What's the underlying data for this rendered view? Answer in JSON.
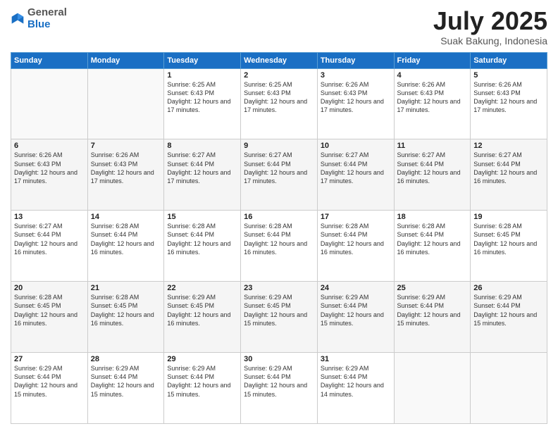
{
  "header": {
    "logo_general": "General",
    "logo_blue": "Blue",
    "month": "July 2025",
    "location": "Suak Bakung, Indonesia"
  },
  "weekdays": [
    "Sunday",
    "Monday",
    "Tuesday",
    "Wednesday",
    "Thursday",
    "Friday",
    "Saturday"
  ],
  "weeks": [
    [
      {
        "day": "",
        "sunrise": "",
        "sunset": "",
        "daylight": ""
      },
      {
        "day": "",
        "sunrise": "",
        "sunset": "",
        "daylight": ""
      },
      {
        "day": "1",
        "sunrise": "Sunrise: 6:25 AM",
        "sunset": "Sunset: 6:43 PM",
        "daylight": "Daylight: 12 hours and 17 minutes."
      },
      {
        "day": "2",
        "sunrise": "Sunrise: 6:25 AM",
        "sunset": "Sunset: 6:43 PM",
        "daylight": "Daylight: 12 hours and 17 minutes."
      },
      {
        "day": "3",
        "sunrise": "Sunrise: 6:26 AM",
        "sunset": "Sunset: 6:43 PM",
        "daylight": "Daylight: 12 hours and 17 minutes."
      },
      {
        "day": "4",
        "sunrise": "Sunrise: 6:26 AM",
        "sunset": "Sunset: 6:43 PM",
        "daylight": "Daylight: 12 hours and 17 minutes."
      },
      {
        "day": "5",
        "sunrise": "Sunrise: 6:26 AM",
        "sunset": "Sunset: 6:43 PM",
        "daylight": "Daylight: 12 hours and 17 minutes."
      }
    ],
    [
      {
        "day": "6",
        "sunrise": "Sunrise: 6:26 AM",
        "sunset": "Sunset: 6:43 PM",
        "daylight": "Daylight: 12 hours and 17 minutes."
      },
      {
        "day": "7",
        "sunrise": "Sunrise: 6:26 AM",
        "sunset": "Sunset: 6:43 PM",
        "daylight": "Daylight: 12 hours and 17 minutes."
      },
      {
        "day": "8",
        "sunrise": "Sunrise: 6:27 AM",
        "sunset": "Sunset: 6:44 PM",
        "daylight": "Daylight: 12 hours and 17 minutes."
      },
      {
        "day": "9",
        "sunrise": "Sunrise: 6:27 AM",
        "sunset": "Sunset: 6:44 PM",
        "daylight": "Daylight: 12 hours and 17 minutes."
      },
      {
        "day": "10",
        "sunrise": "Sunrise: 6:27 AM",
        "sunset": "Sunset: 6:44 PM",
        "daylight": "Daylight: 12 hours and 17 minutes."
      },
      {
        "day": "11",
        "sunrise": "Sunrise: 6:27 AM",
        "sunset": "Sunset: 6:44 PM",
        "daylight": "Daylight: 12 hours and 16 minutes."
      },
      {
        "day": "12",
        "sunrise": "Sunrise: 6:27 AM",
        "sunset": "Sunset: 6:44 PM",
        "daylight": "Daylight: 12 hours and 16 minutes."
      }
    ],
    [
      {
        "day": "13",
        "sunrise": "Sunrise: 6:27 AM",
        "sunset": "Sunset: 6:44 PM",
        "daylight": "Daylight: 12 hours and 16 minutes."
      },
      {
        "day": "14",
        "sunrise": "Sunrise: 6:28 AM",
        "sunset": "Sunset: 6:44 PM",
        "daylight": "Daylight: 12 hours and 16 minutes."
      },
      {
        "day": "15",
        "sunrise": "Sunrise: 6:28 AM",
        "sunset": "Sunset: 6:44 PM",
        "daylight": "Daylight: 12 hours and 16 minutes."
      },
      {
        "day": "16",
        "sunrise": "Sunrise: 6:28 AM",
        "sunset": "Sunset: 6:44 PM",
        "daylight": "Daylight: 12 hours and 16 minutes."
      },
      {
        "day": "17",
        "sunrise": "Sunrise: 6:28 AM",
        "sunset": "Sunset: 6:44 PM",
        "daylight": "Daylight: 12 hours and 16 minutes."
      },
      {
        "day": "18",
        "sunrise": "Sunrise: 6:28 AM",
        "sunset": "Sunset: 6:44 PM",
        "daylight": "Daylight: 12 hours and 16 minutes."
      },
      {
        "day": "19",
        "sunrise": "Sunrise: 6:28 AM",
        "sunset": "Sunset: 6:45 PM",
        "daylight": "Daylight: 12 hours and 16 minutes."
      }
    ],
    [
      {
        "day": "20",
        "sunrise": "Sunrise: 6:28 AM",
        "sunset": "Sunset: 6:45 PM",
        "daylight": "Daylight: 12 hours and 16 minutes."
      },
      {
        "day": "21",
        "sunrise": "Sunrise: 6:28 AM",
        "sunset": "Sunset: 6:45 PM",
        "daylight": "Daylight: 12 hours and 16 minutes."
      },
      {
        "day": "22",
        "sunrise": "Sunrise: 6:29 AM",
        "sunset": "Sunset: 6:45 PM",
        "daylight": "Daylight: 12 hours and 16 minutes."
      },
      {
        "day": "23",
        "sunrise": "Sunrise: 6:29 AM",
        "sunset": "Sunset: 6:45 PM",
        "daylight": "Daylight: 12 hours and 15 minutes."
      },
      {
        "day": "24",
        "sunrise": "Sunrise: 6:29 AM",
        "sunset": "Sunset: 6:44 PM",
        "daylight": "Daylight: 12 hours and 15 minutes."
      },
      {
        "day": "25",
        "sunrise": "Sunrise: 6:29 AM",
        "sunset": "Sunset: 6:44 PM",
        "daylight": "Daylight: 12 hours and 15 minutes."
      },
      {
        "day": "26",
        "sunrise": "Sunrise: 6:29 AM",
        "sunset": "Sunset: 6:44 PM",
        "daylight": "Daylight: 12 hours and 15 minutes."
      }
    ],
    [
      {
        "day": "27",
        "sunrise": "Sunrise: 6:29 AM",
        "sunset": "Sunset: 6:44 PM",
        "daylight": "Daylight: 12 hours and 15 minutes."
      },
      {
        "day": "28",
        "sunrise": "Sunrise: 6:29 AM",
        "sunset": "Sunset: 6:44 PM",
        "daylight": "Daylight: 12 hours and 15 minutes."
      },
      {
        "day": "29",
        "sunrise": "Sunrise: 6:29 AM",
        "sunset": "Sunset: 6:44 PM",
        "daylight": "Daylight: 12 hours and 15 minutes."
      },
      {
        "day": "30",
        "sunrise": "Sunrise: 6:29 AM",
        "sunset": "Sunset: 6:44 PM",
        "daylight": "Daylight: 12 hours and 15 minutes."
      },
      {
        "day": "31",
        "sunrise": "Sunrise: 6:29 AM",
        "sunset": "Sunset: 6:44 PM",
        "daylight": "Daylight: 12 hours and 14 minutes."
      },
      {
        "day": "",
        "sunrise": "",
        "sunset": "",
        "daylight": ""
      },
      {
        "day": "",
        "sunrise": "",
        "sunset": "",
        "daylight": ""
      }
    ]
  ]
}
